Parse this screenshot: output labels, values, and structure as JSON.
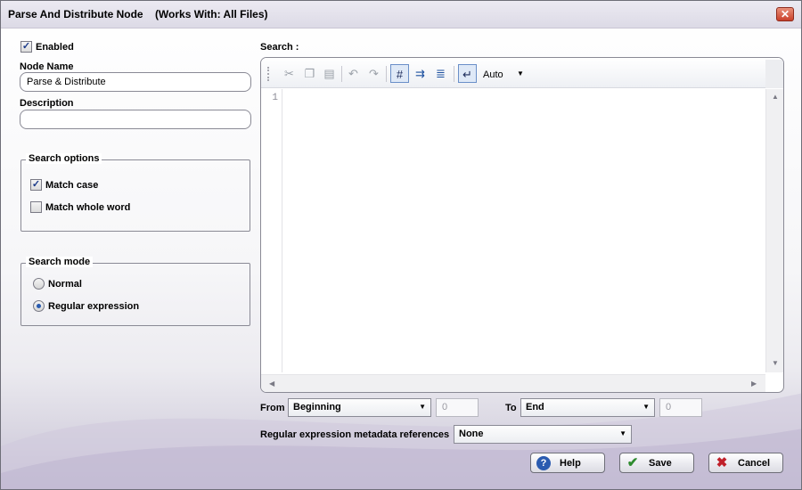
{
  "window": {
    "title": "Parse And Distribute Node",
    "subtitle": "(Works With: All Files)",
    "close_label": "✕"
  },
  "left": {
    "enabled_label": "Enabled",
    "enabled_checked": true,
    "node_name_label": "Node Name",
    "node_name_value": "Parse & Distribute",
    "description_label": "Description",
    "description_value": "",
    "search_options": {
      "legend": "Search options",
      "match_case_label": "Match case",
      "match_case_checked": true,
      "match_whole_word_label": "Match whole word",
      "match_whole_word_checked": false
    },
    "search_mode": {
      "legend": "Search mode",
      "normal_label": "Normal",
      "regex_label": "Regular expression",
      "selected": "Regular expression"
    }
  },
  "right": {
    "search_label": "Search :",
    "toolbar": {
      "icons": [
        "cut-icon",
        "copy-icon",
        "paste-icon",
        "undo-icon",
        "redo-icon",
        "line-numbers-icon",
        "show-whitespace-icon",
        "word-wrap-icon",
        "newline-icon"
      ],
      "encoding_value": "Auto"
    },
    "editor": {
      "line_number": "1",
      "content": ""
    },
    "from_label": "From",
    "from_value": "Beginning",
    "from_number": "0",
    "to_label": "To",
    "to_value": "End",
    "to_number": "0",
    "metadata_label": "Regular expression metadata references",
    "metadata_value": "None"
  },
  "buttons": {
    "help_label": "Help",
    "save_label": "Save",
    "cancel_label": "Cancel"
  },
  "colors": {
    "accent": "#2a5bb0",
    "save_check": "#2e8b2e",
    "cancel_x": "#c0202a"
  }
}
